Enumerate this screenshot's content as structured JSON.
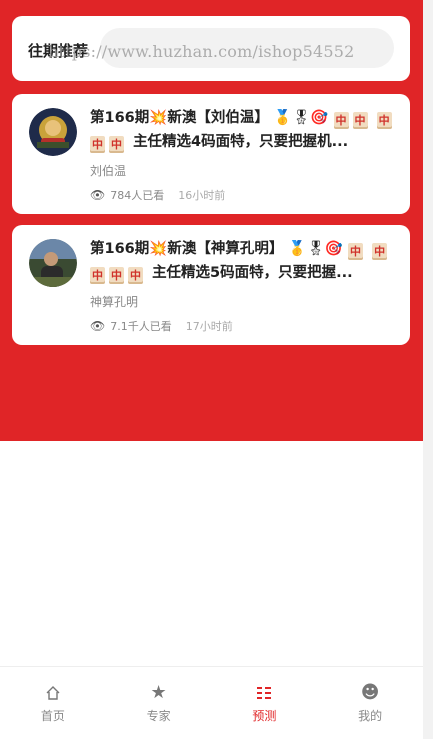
{
  "filter": {
    "label": "往期推荐",
    "placeholder": ""
  },
  "watermark": "https://www.huzhan.com/ishop54552",
  "posts": [
    {
      "title_prefix": "第166期",
      "title_mid": "新澳【刘伯温】",
      "tiles_line1": [
        "中",
        "中"
      ],
      "tiles_line2": [
        "中",
        "中",
        "中"
      ],
      "title_suffix": "主任精选4码面特，只要把握机...",
      "author": "刘伯温",
      "views": "784人已看",
      "time": "16小时前"
    },
    {
      "title_prefix": "第166期",
      "title_mid": "新澳【神算孔明】",
      "tiles_line1": [
        "中"
      ],
      "tiles_line2": [
        "中",
        "中",
        "中",
        "中"
      ],
      "title_suffix": "主任精选5码面特，只要把握...",
      "author": "神算孔明",
      "views": "7.1千人已看",
      "time": "17小时前"
    }
  ],
  "tabbar": {
    "items": [
      {
        "label": "首页",
        "icon": "home-icon"
      },
      {
        "label": "专家",
        "icon": "star-icon"
      },
      {
        "label": "预测",
        "icon": "list-icon"
      },
      {
        "label": "我的",
        "icon": "smile-icon"
      }
    ],
    "active_index": 2
  },
  "colors": {
    "accent": "#e02527",
    "tile": "#f1dcc0"
  }
}
